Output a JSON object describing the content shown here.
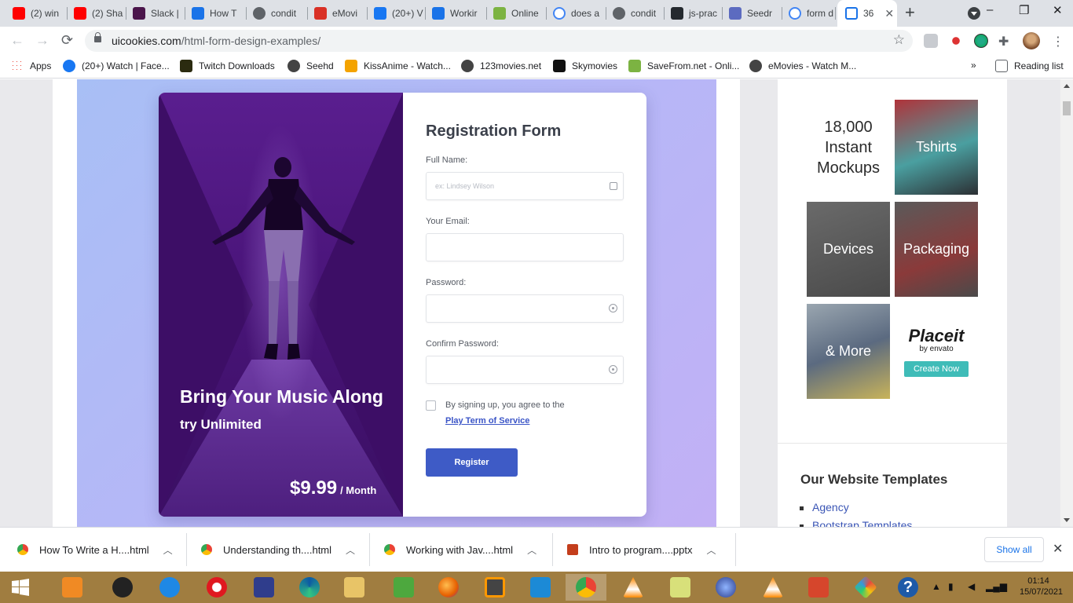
{
  "browser": {
    "tabs": [
      {
        "label": "(2) win",
        "icon": "youtube-icon",
        "color": "#ff0000"
      },
      {
        "label": "(2) Sha",
        "icon": "youtube-icon",
        "color": "#ff0000"
      },
      {
        "label": "Slack |",
        "icon": "slack-icon",
        "color": "#4a154b"
      },
      {
        "label": "How T",
        "icon": "loading-icon",
        "color": "#1a73e8"
      },
      {
        "label": "condit",
        "icon": "globe-icon",
        "color": "#5f6368"
      },
      {
        "label": "eMovi",
        "icon": "emovies-icon",
        "color": "#d93025"
      },
      {
        "label": "(20+) V",
        "icon": "facebook-icon",
        "color": "#1877f2"
      },
      {
        "label": "Workir",
        "icon": "loading-icon",
        "color": "#1a73e8"
      },
      {
        "label": "Online",
        "icon": "download-icon",
        "color": "#7cb342"
      },
      {
        "label": "does a",
        "icon": "google-icon",
        "color": "#4285f4"
      },
      {
        "label": "condit",
        "icon": "globe-icon",
        "color": "#5f6368"
      },
      {
        "label": "js-prac",
        "icon": "github-icon",
        "color": "#24292e"
      },
      {
        "label": "Seedr",
        "icon": "seedr-icon",
        "color": "#5c6bc0"
      },
      {
        "label": "form d",
        "icon": "google-icon",
        "color": "#4285f4"
      }
    ],
    "active_tab": {
      "label": "36",
      "icon": "uicookies-icon",
      "color": "#1a73e8"
    },
    "new_tab": "+",
    "window_controls": {
      "minimize": "–",
      "restore": "❐",
      "close": "✕"
    },
    "nav": {
      "back": "←",
      "forward": "→",
      "reload": "⟳"
    },
    "url": {
      "domain": "uicookies.com",
      "path": "/html-form-design-examples/"
    },
    "bookmarks": [
      {
        "label": "Apps",
        "icon": "apps-grid-icon",
        "color": "#ea4335"
      },
      {
        "label": "(20+) Watch | Face...",
        "icon": "facebook-icon",
        "color": "#1877f2"
      },
      {
        "label": "Twitch Downloads",
        "icon": "twitch-icon",
        "color": "#2b2b10"
      },
      {
        "label": "Seehd",
        "icon": "globe-icon",
        "color": "#444"
      },
      {
        "label": "KissAnime - Watch...",
        "icon": "kissanime-icon",
        "color": "#f4a300"
      },
      {
        "label": "123movies.net",
        "icon": "globe-icon",
        "color": "#444"
      },
      {
        "label": "Skymovies",
        "icon": "sky-icon",
        "color": "#111"
      },
      {
        "label": "SaveFrom.net - Onli...",
        "icon": "download-icon",
        "color": "#7cb342"
      },
      {
        "label": "eMovies - Watch M...",
        "icon": "globe-icon",
        "color": "#444"
      }
    ],
    "bookmarks_more": "»",
    "reading_list": "Reading list"
  },
  "form_card": {
    "photo_title": "Bring Your Music Along",
    "photo_subtitle": "try Unlimited",
    "price": "$9.99",
    "price_period": "/ Month",
    "title": "Registration Form",
    "full_name_label": "Full Name:",
    "full_name_placeholder": "ex: Lindsey Wilson",
    "email_label": "Your Email:",
    "password_label": "Password:",
    "confirm_label": "Confirm Password:",
    "agree_text": "By signing up, you agree to the",
    "tos_link": "Play Term of Service",
    "register_button": "Register",
    "accent_color": "#3e5bc6"
  },
  "sidebar": {
    "ad": {
      "headline": [
        "18,000",
        "Instant",
        "Mockups"
      ],
      "tiles": [
        "Tshirts",
        "Devices",
        "Packaging",
        "& More"
      ],
      "brand": "Placeit",
      "brand_by": "by envato",
      "cta": "Create Now"
    },
    "section_title": "Our Website Templates",
    "links": [
      "Agency",
      "Bootstrap Templates"
    ]
  },
  "downloads": [
    {
      "name": "How To Write a H....html",
      "icon": "chrome-icon"
    },
    {
      "name": "Understanding th....html",
      "icon": "chrome-icon"
    },
    {
      "name": "Working with Jav....html",
      "icon": "chrome-icon"
    },
    {
      "name": "Intro to program....pptx",
      "icon": "powerpoint-icon"
    }
  ],
  "downloads_show_all": "Show all",
  "taskbar": {
    "time": "01:14",
    "date": "15/07/2021"
  }
}
